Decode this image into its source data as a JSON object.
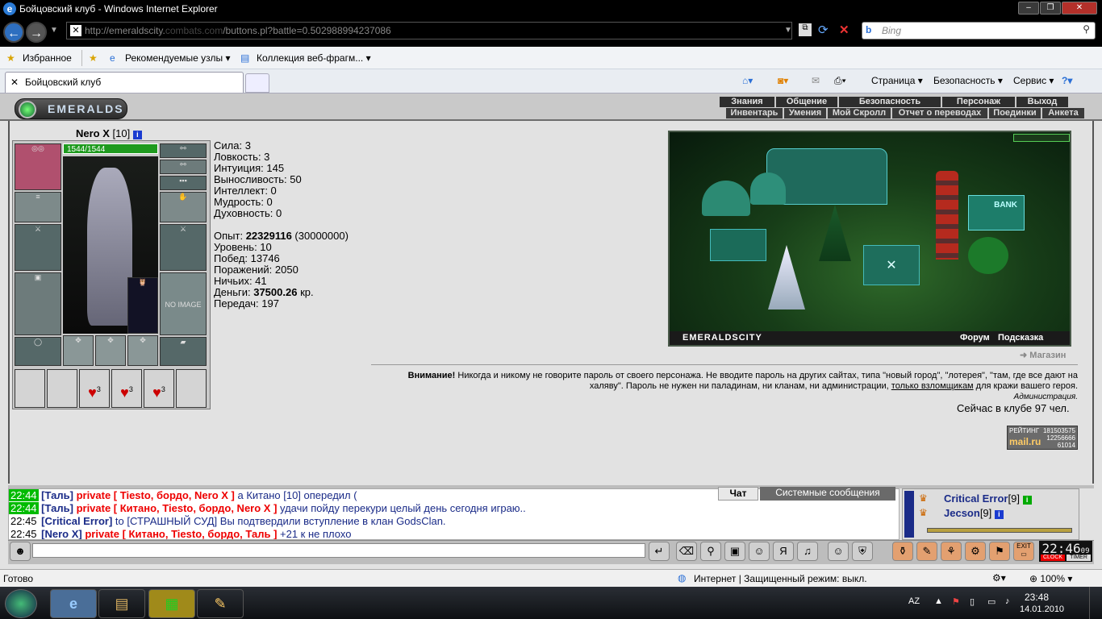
{
  "window": {
    "title": "Бойцовский клуб - Windows Internet Explorer"
  },
  "address": {
    "url_prefix": "http://emeraldscity.",
    "url_hidden": "combats.com",
    "url_suffix": "/buttons.pl?battle=0.502988994237086",
    "search_placeholder": "Bing"
  },
  "favbar": {
    "favorites": "Избранное",
    "recommended": "Рекомендуемые узлы",
    "collection": "Коллекция веб-фрагм..."
  },
  "tab": {
    "title": "Бойцовский клуб"
  },
  "commands": {
    "page": "Страница",
    "safety": "Безопасность",
    "service": "Сервис"
  },
  "game": {
    "logo": "EMERALDS",
    "menu_top": [
      "Знания",
      "Общение",
      "Безопасность",
      "Персонаж",
      "Выход"
    ],
    "menu_sub": [
      "Инвентарь",
      "Умения",
      "Мой Скролл",
      "Отчет о переводах",
      "Поединки",
      "Анкета"
    ],
    "char": {
      "name": "Nero X",
      "level": "[10]",
      "hp": "1544/1544",
      "no_image": "NO IMAGE",
      "charm_count": "3"
    },
    "stats": {
      "strength": "Сила: 3",
      "agility": "Ловкость: 3",
      "intuition": "Интуиция: 145",
      "endurance": "Выносливость: 50",
      "intellect": "Интеллект: 0",
      "wisdom": "Мудрость: 0",
      "spirit": "Духовность: 0",
      "exp_label": "Опыт: ",
      "exp_value": "22329116",
      "exp_next": " (30000000)",
      "level": "Уровень: 10",
      "wins": "Побед: 13746",
      "losses": "Поражений: 2050",
      "draws": "Ничьих: 41",
      "money_label": "Деньги: ",
      "money_value": "37500.26",
      "money_unit": " кр.",
      "transfers": "Передач: 197"
    },
    "city": {
      "name": "EMERALDSCITY",
      "forum": "Форум",
      "hint": "Подсказка",
      "bank": "BANK",
      "shop": "Магазин"
    },
    "warning": {
      "bold": "Внимание!",
      "text1": " Никогда и никому не говорите пароль от своего персонажа. Не вводите пароль на других сайтах, типа \"новый город\", \"лотерея\", \"там, где все дают на халяву\". Пароль не нужен ни паладинам, ни кланам, ни администрации, ",
      "link": "только взломщикам",
      "text2": " для кражи вашего героя.",
      "sign": "Администрация."
    },
    "online": "Сейчас в клубе 97 чел.",
    "rating": {
      "label": "РЕЙТИНГ",
      "brand": "mail.ru",
      "n1": "181503575",
      "n2": "12256666",
      "n3": "61014"
    }
  },
  "chat": {
    "tab_chat": "Чат",
    "tab_system": "Системные сообщения",
    "lines": [
      {
        "time": "22:44",
        "nick": "[Таль]",
        "private": "private [ Tiesto, бордо, Nero X ]",
        "text": " а Китано [10] опередил ("
      },
      {
        "time": "22:44",
        "nick": "[Таль]",
        "private": "private [ Китано, Tiesto, бордо, Nero X ]",
        "text": " удачи пойду перекури целый день сегодня играю.."
      },
      {
        "time": "22:45",
        "nick": "[Critical Error]",
        "private": "",
        "text": " to [СТРАШНЫЙ СУД] Вы подтвердили вступление в клан GodsClan."
      },
      {
        "time": "22:45",
        "nick": "[Nero X]",
        "private": "private [ Китано, Tiesto, бордо, Таль ]",
        "text": " +21 к не плохо"
      }
    ],
    "users": [
      {
        "name": "Critical Error",
        "level": "[9]"
      },
      {
        "name": "Jecson",
        "level": "[9]"
      }
    ]
  },
  "clock": {
    "time": "22:46",
    "sec": "09",
    "clock_label": "CLOCK",
    "timer_label": "TIMER",
    "exit": "EXIT"
  },
  "statusbar": {
    "ready": "Готово",
    "zone": "Интернет | Защищенный режим: выкл.",
    "zoom": "100%"
  },
  "taskbar": {
    "lang": "AZ",
    "time": "23:48",
    "date": "14.01.2010"
  }
}
